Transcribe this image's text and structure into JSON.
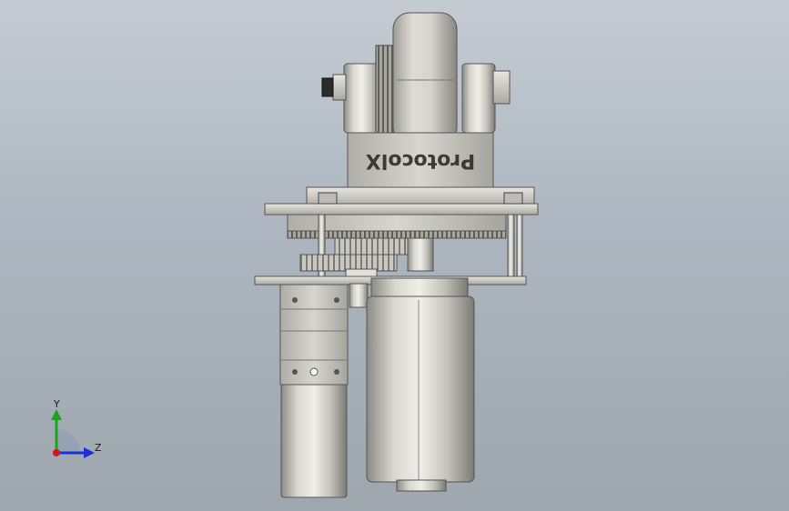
{
  "model": {
    "brand_text": "ProtocolX"
  },
  "triad": {
    "y_label": "Y",
    "z_label": "Z",
    "y_color": "#1aa51a",
    "z_color": "#1d2fd6",
    "origin_color": "#d01818"
  }
}
